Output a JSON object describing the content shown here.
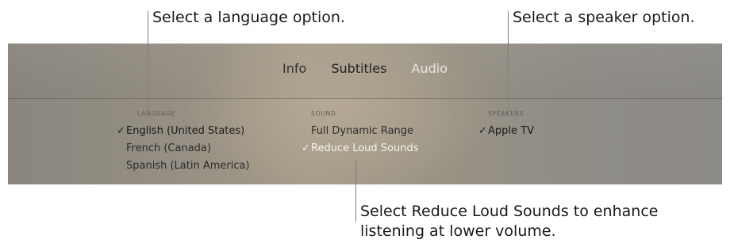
{
  "callouts": {
    "language": "Select a language option.",
    "speaker": "Select a speaker option.",
    "reduce_line1": "Select Reduce Loud Sounds to enhance",
    "reduce_line2": "listening at lower volume."
  },
  "tabs": [
    {
      "label": "Info",
      "active": false
    },
    {
      "label": "Subtitles",
      "active": false
    },
    {
      "label": "Audio",
      "active": true
    }
  ],
  "columns": {
    "language": {
      "header": "LANGUAGE",
      "options": [
        {
          "label": "English (United States)",
          "selected": true
        },
        {
          "label": "French (Canada)",
          "selected": false
        },
        {
          "label": "Spanish (Latin America)",
          "selected": false
        }
      ]
    },
    "sound": {
      "header": "SOUND",
      "options": [
        {
          "label": "Full Dynamic Range",
          "selected": false
        },
        {
          "label": "Reduce Loud Sounds",
          "selected": true
        }
      ]
    },
    "speakers": {
      "header": "SPEAKERS",
      "options": [
        {
          "label": "Apple TV",
          "selected": true
        }
      ]
    }
  },
  "checkmark": "✓",
  "colors": {
    "active_tab": "#e9e6e0",
    "selected_sound_option": "#f5f3ef",
    "panel_base": "#948e83"
  },
  "icons": {
    "checkmark": "check-icon"
  }
}
